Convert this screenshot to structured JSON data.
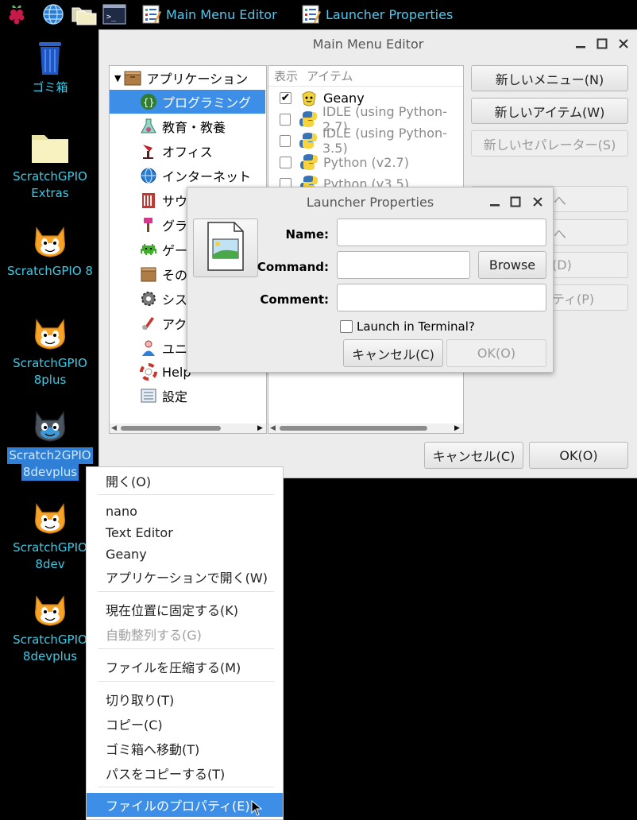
{
  "taskbar": {
    "icons": [
      "raspberry-menu-icon",
      "web-browser-icon",
      "file-manager-icon",
      "terminal-icon"
    ],
    "tasks": [
      {
        "label": "Main Menu Editor",
        "icon": "menu-editor-icon"
      },
      {
        "label": "Launcher Properties",
        "icon": "menu-editor-icon"
      }
    ]
  },
  "desktop": {
    "icons": [
      {
        "lines": [
          "ゴミ箱"
        ],
        "icon": "trash-icon"
      },
      {
        "lines": [
          "ScratchGPIO",
          "Extras"
        ],
        "icon": "folder-icon"
      },
      {
        "lines": [
          "ScratchGPIO 8"
        ],
        "icon": "scratch-cat-icon"
      },
      {
        "lines": [
          "ScratchGPIO",
          "8plus"
        ],
        "icon": "scratch-cat-icon"
      },
      {
        "lines": [
          "Scratch2GPIO",
          "8devplus"
        ],
        "icon": "scratch2-cat-icon",
        "selected": true
      },
      {
        "lines": [
          "ScratchGPIO",
          "8dev"
        ],
        "icon": "scratch-cat-icon"
      },
      {
        "lines": [
          "ScratchGPIO",
          "8devplus"
        ],
        "icon": "scratch-cat-icon"
      }
    ]
  },
  "main_menu_editor": {
    "title": "Main Menu Editor",
    "tree_root": "アプリケーション",
    "tree_items": [
      {
        "label": "プログラミング",
        "icon": "programming-icon",
        "selected": true
      },
      {
        "label": "教育・教養",
        "icon": "education-icon"
      },
      {
        "label": "オフィス",
        "icon": "office-icon"
      },
      {
        "label": "インターネット",
        "icon": "internet-icon"
      },
      {
        "label": "サウ",
        "icon": "sound-video-icon"
      },
      {
        "label": "グラ",
        "icon": "graphics-icon"
      },
      {
        "label": "ゲー",
        "icon": "games-icon"
      },
      {
        "label": "その",
        "icon": "other-icon"
      },
      {
        "label": "シス",
        "icon": "system-tools-icon"
      },
      {
        "label": "アク",
        "icon": "accessories-icon"
      },
      {
        "label": "ユニ",
        "icon": "universal-access-icon"
      },
      {
        "label": "Help",
        "icon": "help-icon"
      },
      {
        "label": "設定",
        "icon": "preferences-icon"
      }
    ],
    "columns": {
      "show": "表示",
      "item": "アイテム"
    },
    "items": [
      {
        "label": "Geany",
        "checked": true,
        "icon": "geany-icon"
      },
      {
        "label": "IDLE (using Python-2.7)",
        "checked": false,
        "icon": "python-icon"
      },
      {
        "label": "IDLE (using Python-3.5)",
        "checked": false,
        "icon": "python-icon"
      },
      {
        "label": "Python (v2.7)",
        "checked": false,
        "icon": "python-icon"
      },
      {
        "label": "Python (v3.5)",
        "checked": false,
        "icon": "python-icon"
      }
    ],
    "buttons": {
      "new_menu": "新しいメニュー(N)",
      "new_item": "新しいアイテム(W)",
      "new_separator": "新しいセパレーター(S)",
      "move_up_partial": "へ",
      "move_down_partial": "へ",
      "delete_partial": "(D)",
      "properties_partial": "ティ(P)",
      "cancel": "キャンセル(C)",
      "ok": "OK(O)"
    }
  },
  "launcher_properties": {
    "title": "Launcher Properties",
    "name_label": "Name:",
    "command_label": "Command:",
    "comment_label": "Comment:",
    "name_value": "",
    "command_value": "",
    "comment_value": "",
    "browse": "Browse",
    "terminal_label": "Launch in Terminal?",
    "terminal_checked": false,
    "cancel": "キャンセル(C)",
    "ok": "OK(O)"
  },
  "context_menu": {
    "groups": [
      [
        {
          "label": "開く(O)"
        }
      ],
      [
        {
          "label": "nano"
        },
        {
          "label": "Text Editor"
        },
        {
          "label": "Geany"
        },
        {
          "label": "アプリケーションで開く(W)"
        }
      ],
      [
        {
          "label": "現在位置に固定する(K)"
        },
        {
          "label": "自動整列する(G)",
          "disabled": true
        }
      ],
      [
        {
          "label": "ファイルを圧縮する(M)"
        }
      ],
      [
        {
          "label": "切り取り(T)"
        },
        {
          "label": "コピー(C)"
        },
        {
          "label": "ゴミ箱へ移動(T)"
        },
        {
          "label": "パスをコピーする(T)"
        }
      ],
      [
        {
          "label": "ファイルのプロパティ(E)",
          "selected": true
        }
      ]
    ]
  }
}
